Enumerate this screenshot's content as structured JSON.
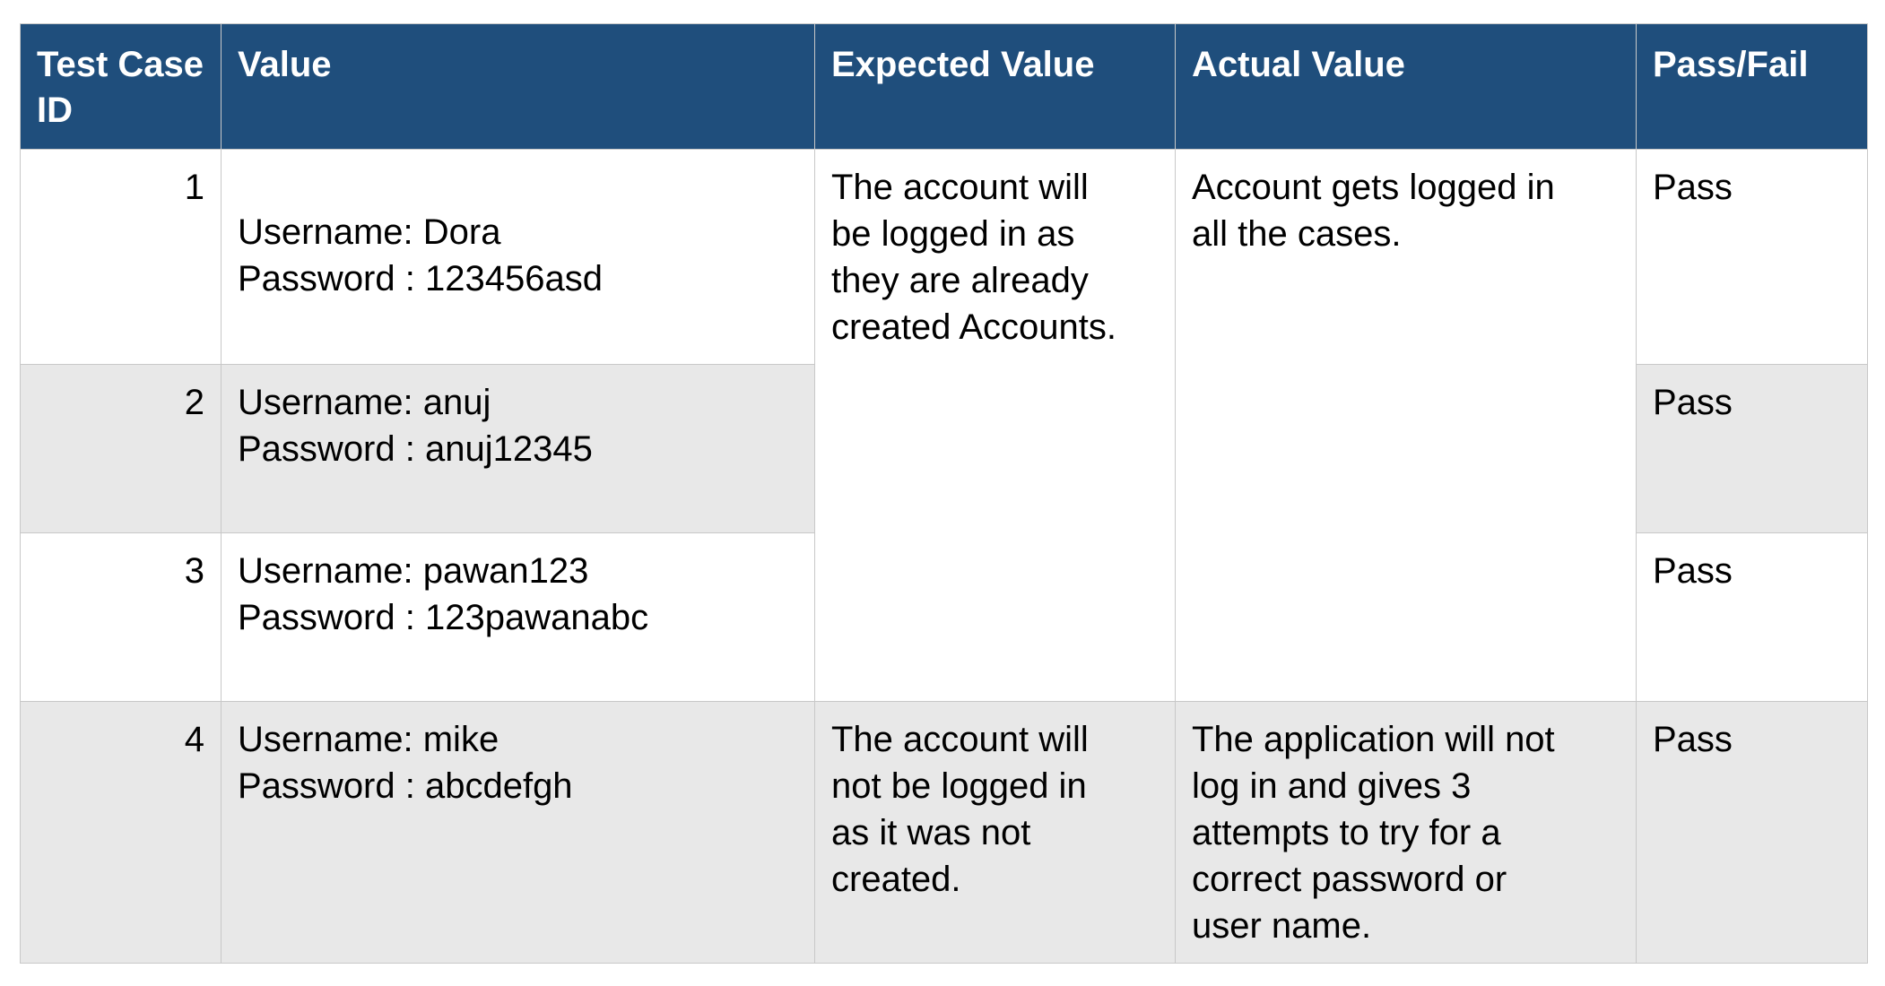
{
  "headers": {
    "test_case_id": "Test Case ID",
    "value": "Value",
    "expected_value": "Expected Value",
    "actual_value": "Actual Value",
    "pass_fail": "Pass/Fail"
  },
  "rows": [
    {
      "id": "1",
      "username": "Username: Dora",
      "password": "Password : 123456asd",
      "result": "Pass"
    },
    {
      "id": "2",
      "username": "Username: anuj",
      "password": "Password : anuj12345",
      "result": "Pass"
    },
    {
      "id": "3",
      "username": "Username: pawan123",
      "password": "Password : 123pawanabc",
      "result": "Pass"
    },
    {
      "id": "4",
      "username": "Username: mike",
      "password": "Password : abcdefgh",
      "result": "Pass"
    }
  ],
  "merged": {
    "expected_value_rows_1_3": [
      "The account will",
      "be logged in as",
      "they are already",
      "created Accounts."
    ],
    "actual_value_rows_1_3": [
      "Account gets logged in",
      "all the cases."
    ]
  },
  "row4": {
    "expected_value": [
      "The account will",
      "not be logged in",
      "as it was not",
      "created."
    ],
    "actual_value": [
      "The application will not",
      "log in and gives 3",
      "attempts to try for a",
      "correct password or",
      "user name."
    ]
  },
  "colors": {
    "header_bg": "#1f4e7c",
    "header_text": "#ffffff",
    "row_shade": "#e8e8e8",
    "border": "#c8c8c8"
  }
}
